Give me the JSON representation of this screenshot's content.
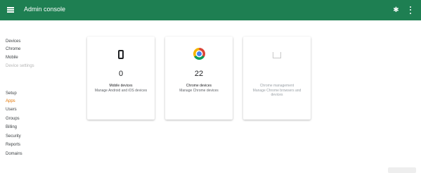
{
  "header": {
    "title": "Admin console"
  },
  "sidebar": {
    "items": [
      {
        "label": "Devices",
        "style": ""
      },
      {
        "label": "Chrome",
        "style": ""
      },
      {
        "label": "Mobile",
        "style": ""
      },
      {
        "label": "Device settings",
        "style": "muted"
      },
      {
        "label": "Setup",
        "style": "header"
      },
      {
        "label": "Apps",
        "style": "accent"
      },
      {
        "label": "Users",
        "style": ""
      },
      {
        "label": "Groups",
        "style": ""
      },
      {
        "label": "Billing",
        "style": ""
      },
      {
        "label": "Security",
        "style": ""
      },
      {
        "label": "Reports",
        "style": ""
      },
      {
        "label": "Domains",
        "style": ""
      }
    ]
  },
  "cards": [
    {
      "count": "0",
      "label": "Mobile devices",
      "desc": "Manage Android and iOS devices",
      "icon": "phone-icon"
    },
    {
      "count": "22",
      "label": "Chrome devices",
      "desc": "Manage Chrome devices",
      "icon": "chrome-icon"
    },
    {
      "count": "",
      "label": "Chrome management",
      "desc": "Manage Chrome browsers and devices",
      "icon": "tablet-icon"
    }
  ],
  "colors": {
    "topbar": "#1e7f52",
    "accent": "#e37400"
  }
}
